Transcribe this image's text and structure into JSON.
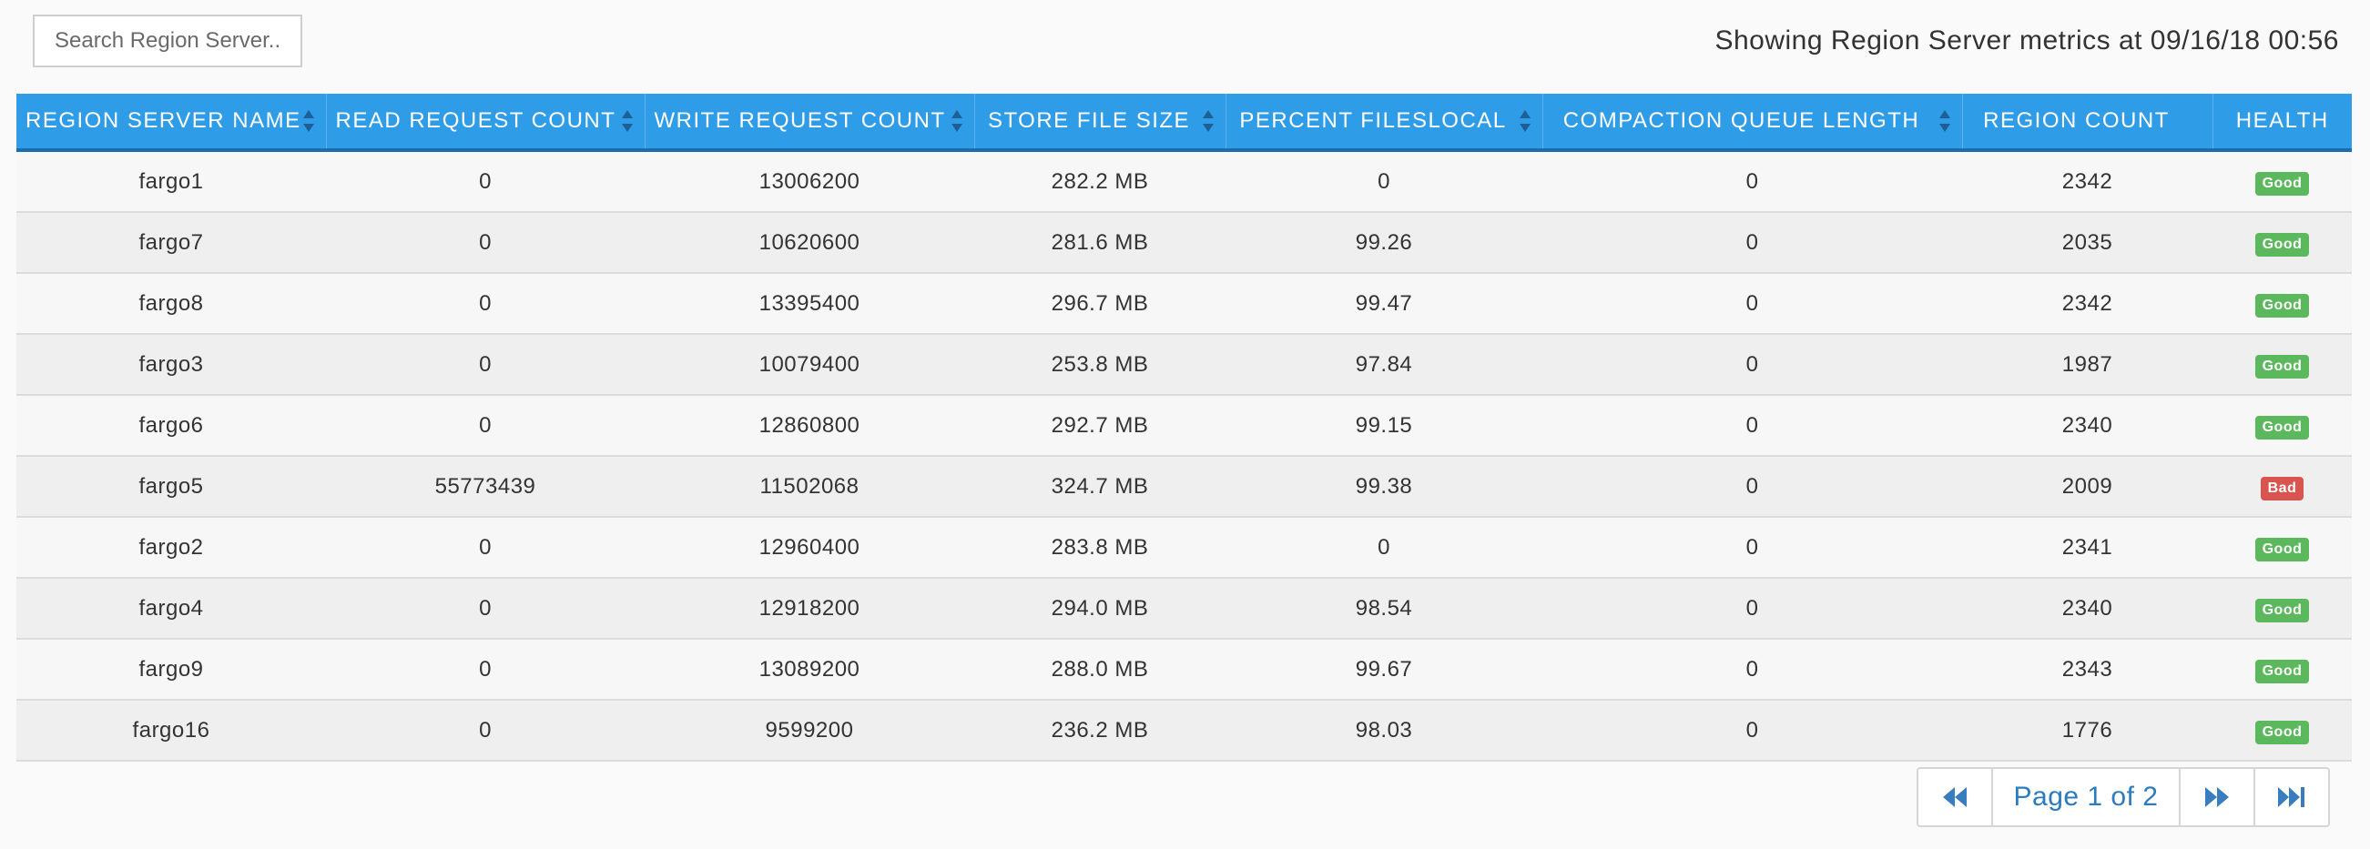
{
  "search": {
    "placeholder": "Search Region Server..."
  },
  "status": {
    "timestamp_text": "Showing Region Server metrics at 09/16/18 00:56"
  },
  "table": {
    "columns": [
      {
        "label": "REGION SERVER NAME",
        "sortable": true
      },
      {
        "label": "READ REQUEST COUNT",
        "sortable": true
      },
      {
        "label": "WRITE REQUEST COUNT",
        "sortable": true
      },
      {
        "label": "STORE FILE SIZE",
        "sortable": true
      },
      {
        "label": "PERCENT FILESLOCAL",
        "sortable": true
      },
      {
        "label": "COMPACTION QUEUE LENGTH",
        "sortable": true
      },
      {
        "label": "REGION COUNT",
        "sortable": false
      },
      {
        "label": "HEALTH",
        "sortable": false
      }
    ],
    "rows": [
      {
        "name": "fargo1",
        "read": "0",
        "write": "13006200",
        "size": "282.2 MB",
        "local": "0",
        "queue": "0",
        "regions": "2342",
        "health": "Good"
      },
      {
        "name": "fargo7",
        "read": "0",
        "write": "10620600",
        "size": "281.6 MB",
        "local": "99.26",
        "queue": "0",
        "regions": "2035",
        "health": "Good"
      },
      {
        "name": "fargo8",
        "read": "0",
        "write": "13395400",
        "size": "296.7 MB",
        "local": "99.47",
        "queue": "0",
        "regions": "2342",
        "health": "Good"
      },
      {
        "name": "fargo3",
        "read": "0",
        "write": "10079400",
        "size": "253.8 MB",
        "local": "97.84",
        "queue": "0",
        "regions": "1987",
        "health": "Good"
      },
      {
        "name": "fargo6",
        "read": "0",
        "write": "12860800",
        "size": "292.7 MB",
        "local": "99.15",
        "queue": "0",
        "regions": "2340",
        "health": "Good"
      },
      {
        "name": "fargo5",
        "read": "55773439",
        "write": "11502068",
        "size": "324.7 MB",
        "local": "99.38",
        "queue": "0",
        "regions": "2009",
        "health": "Bad"
      },
      {
        "name": "fargo2",
        "read": "0",
        "write": "12960400",
        "size": "283.8 MB",
        "local": "0",
        "queue": "0",
        "regions": "2341",
        "health": "Good"
      },
      {
        "name": "fargo4",
        "read": "0",
        "write": "12918200",
        "size": "294.0 MB",
        "local": "98.54",
        "queue": "0",
        "regions": "2340",
        "health": "Good"
      },
      {
        "name": "fargo9",
        "read": "0",
        "write": "13089200",
        "size": "288.0 MB",
        "local": "99.67",
        "queue": "0",
        "regions": "2343",
        "health": "Good"
      },
      {
        "name": "fargo16",
        "read": "0",
        "write": "9599200",
        "size": "236.2 MB",
        "local": "98.03",
        "queue": "0",
        "regions": "1776",
        "health": "Good"
      }
    ]
  },
  "health_colors": {
    "Good": "#5cb85c",
    "Bad": "#d9534f"
  },
  "pagination": {
    "label": "Page 1 of 2",
    "first_icon": "rewind-icon",
    "next_icon": "fast-forward-icon",
    "last_icon": "skip-to-end-icon"
  },
  "colors": {
    "header_bg": "#2f9ce8",
    "header_border": "#1b6db0",
    "pager_text": "#2b7bbf",
    "pager_icon": "#3a7dbf"
  }
}
